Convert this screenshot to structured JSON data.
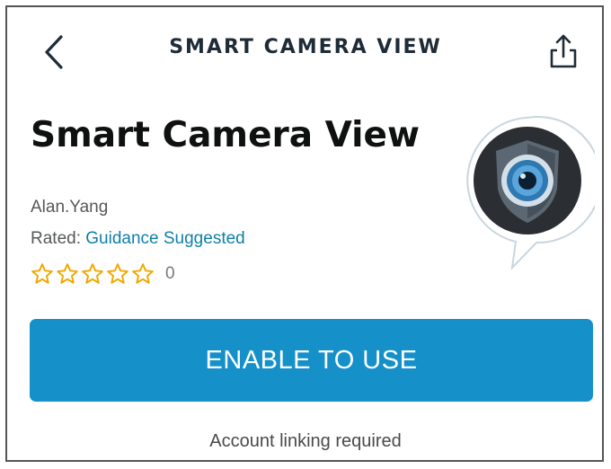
{
  "header": {
    "title": "SMART CAMERA VIEW",
    "back_icon": "chevron-left-icon",
    "share_icon": "share-icon"
  },
  "skill": {
    "title": "Smart Camera View",
    "developer": "Alan.Yang",
    "rated_label": "Rated: ",
    "rated_value": "Guidance Suggested",
    "stars_filled": 0,
    "stars_total": 5,
    "review_count": "0",
    "icon": "security-camera-shield-icon"
  },
  "actions": {
    "enable_label": "ENABLE TO USE",
    "account_note": "Account linking required"
  },
  "colors": {
    "accent": "#1590c9",
    "link": "#0f7fa8",
    "star": "#f0a800"
  }
}
